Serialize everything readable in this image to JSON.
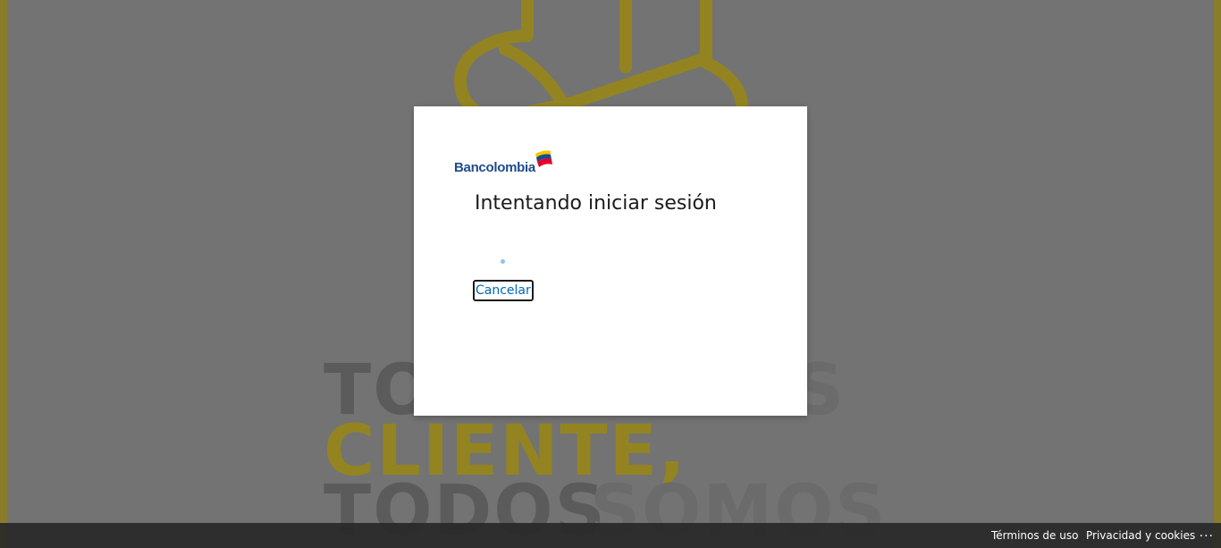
{
  "dialog": {
    "logo_text": "Bancolombia",
    "title": "Intentando iniciar sesión",
    "cancel_label": "Cancelar"
  },
  "background": {
    "line1_left": "TO",
    "line1_right": "S",
    "line2": "CLIENTE,",
    "line3_a": "TODOS",
    "line3_b": "SOMOS",
    "accent_color": "#938421"
  },
  "footer": {
    "terms_label": "Términos de uso",
    "privacy_label": "Privacidad y cookies",
    "more_label": "..."
  },
  "colors": {
    "link": "#0067b8",
    "brand_blue": "#1e4a8c",
    "brand_yellow": "#f7c600",
    "brand_red": "#e4002b"
  }
}
